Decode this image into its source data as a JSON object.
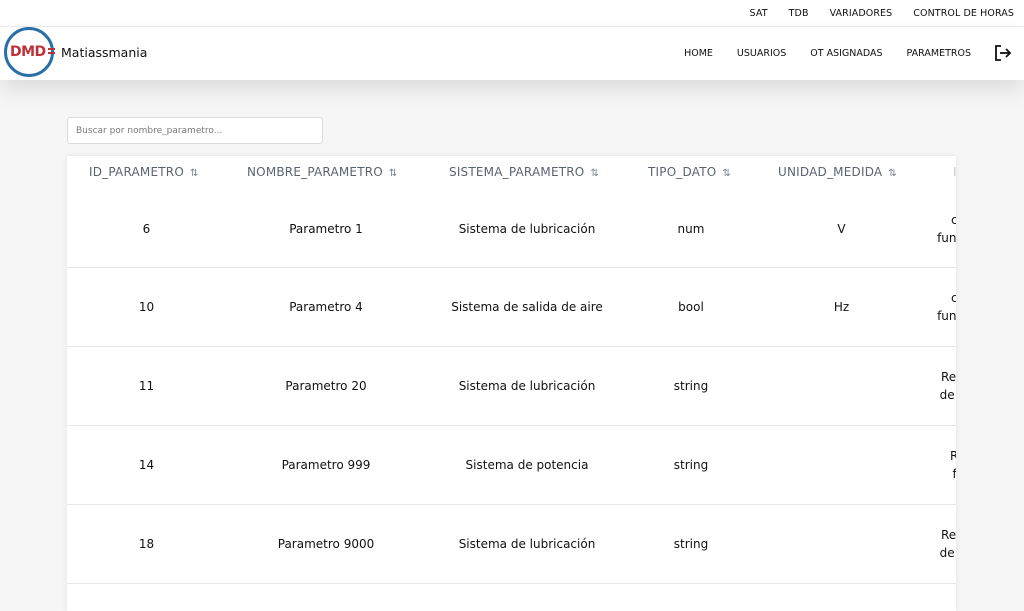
{
  "topbar": {
    "links": [
      "SAT",
      "TDB",
      "VARIADORES",
      "CONTROL DE HORAS"
    ]
  },
  "navbar": {
    "logo_text": "DMD",
    "brand": "Matiassmania",
    "links": [
      "HOME",
      "USUARIOS",
      "OT ASIGNADAS",
      "PARAMETROS"
    ],
    "logout_icon": "logout-icon"
  },
  "search": {
    "placeholder": "Buscar por nombre_parametro...",
    "value": ""
  },
  "table": {
    "columns": [
      "ID_PARAMETRO",
      "NOMBRE_PARAMETRO",
      "SISTEMA_PARAMETRO",
      "TIPO_DATO",
      "UNIDAD_MEDIDA",
      "I"
    ],
    "sort_icon": "⇅",
    "rows": [
      {
        "id": "6",
        "nombre": "Parametro 1",
        "sistema": "Sistema de lubricación",
        "tipo": "num",
        "unidad": "V",
        "desc1": "c",
        "desc2": "fun"
      },
      {
        "id": "10",
        "nombre": "Parametro 4",
        "sistema": "Sistema de salida de aire",
        "tipo": "bool",
        "unidad": "Hz",
        "desc1": "c",
        "desc2": "fun"
      },
      {
        "id": "11",
        "nombre": "Parametro 20",
        "sistema": "Sistema de lubricación",
        "tipo": "string",
        "unidad": "",
        "desc1": "Re",
        "desc2": "de"
      },
      {
        "id": "14",
        "nombre": "Parametro 999",
        "sistema": "Sistema de potencia",
        "tipo": "string",
        "unidad": "",
        "desc1": "R",
        "desc2": "f"
      },
      {
        "id": "18",
        "nombre": "Parametro 9000",
        "sistema": "Sistema de lubricación",
        "tipo": "string",
        "unidad": "",
        "desc1": "Re",
        "desc2": "de"
      }
    ]
  }
}
